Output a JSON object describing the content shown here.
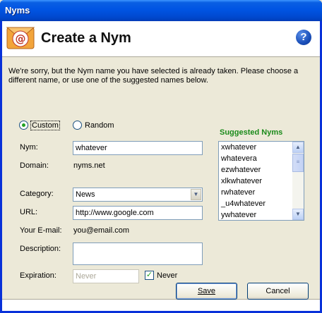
{
  "window": {
    "title": "Nyms"
  },
  "header": {
    "heading": "Create a Nym",
    "help_glyph": "?"
  },
  "intro": "We're sorry, but the Nym name you have selected is already taken. Please choose a different name, or use one of the suggested names below.",
  "mode": {
    "custom_label": "Custom",
    "random_label": "Random",
    "selected": "custom"
  },
  "form": {
    "nym_label": "Nym:",
    "nym_value": "whatever",
    "domain_label": "Domain:",
    "domain_value": "nyms.net",
    "category_label": "Category:",
    "category_value": "News",
    "url_label": "URL:",
    "url_value": "http://www.google.com",
    "email_label": "Your E-mail:",
    "email_value": "you@email.com",
    "description_label": "Description:",
    "description_value": "",
    "expiration_label": "Expiration:",
    "expiration_placeholder": "Never",
    "never_label": "Never",
    "never_checked": true
  },
  "suggested": {
    "title": "Suggested Nyms",
    "items": [
      "xwhatever",
      "whatevera",
      "ezwhatever",
      "xlkwhatever",
      "rwhatever",
      "_u4whatever",
      "ywhatever"
    ]
  },
  "buttons": {
    "save": "Save",
    "cancel": "Cancel"
  },
  "colors": {
    "titlebar": "#0054e3",
    "suggested_title": "#1a8a1a",
    "radio_dot": "#21a121"
  }
}
